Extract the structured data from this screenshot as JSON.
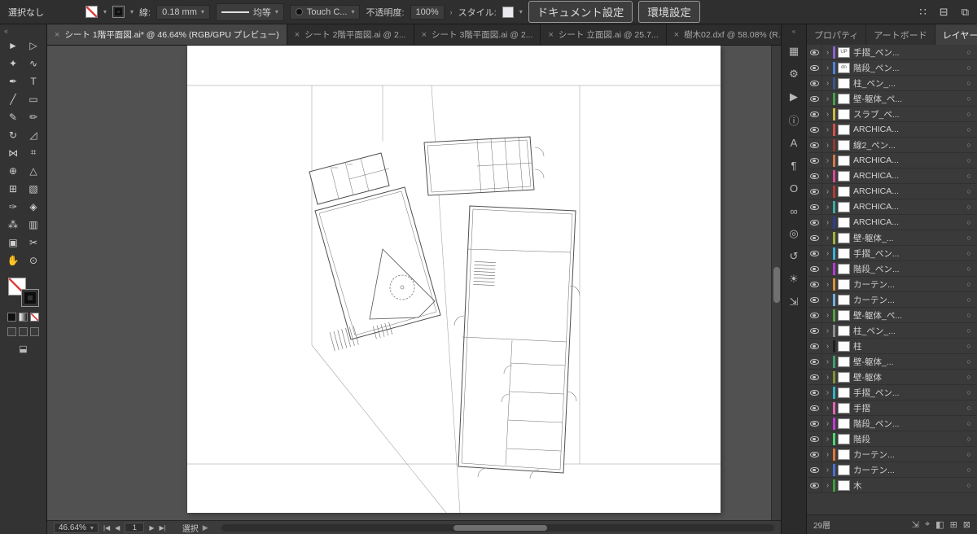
{
  "topbar": {
    "selection_status": "選択なし",
    "stroke_label": "線:",
    "stroke_width": "0.18 mm",
    "profile_label": "均等",
    "brush_name": "Touch C...",
    "opacity_label": "不透明度:",
    "opacity_value": "100%",
    "style_label": "スタイル:",
    "document_setup": "ドキュメント設定",
    "preferences": "環境設定",
    "right_icons": [
      {
        "name": "app-grid-icon",
        "glyph": "∷"
      },
      {
        "name": "panel-layout-icon",
        "glyph": "⊟"
      },
      {
        "name": "arrange-documents-icon",
        "glyph": "⧉"
      }
    ]
  },
  "toolbar": {
    "collapse_glyph": "«",
    "tools": [
      {
        "name": "selection-tool",
        "glyph": "►"
      },
      {
        "name": "direct-selection-tool",
        "glyph": "▷"
      },
      {
        "name": "magic-wand-tool",
        "glyph": "✦"
      },
      {
        "name": "lasso-tool",
        "glyph": "∿"
      },
      {
        "name": "pen-tool",
        "glyph": "✒"
      },
      {
        "name": "type-tool",
        "glyph": "T"
      },
      {
        "name": "line-segment-tool",
        "glyph": "╱"
      },
      {
        "name": "rectangle-tool",
        "glyph": "▭"
      },
      {
        "name": "paintbrush-tool",
        "glyph": "✎"
      },
      {
        "name": "pencil-tool",
        "glyph": "✏"
      },
      {
        "name": "rotate-tool",
        "glyph": "↻"
      },
      {
        "name": "scale-tool",
        "glyph": "◿"
      },
      {
        "name": "width-tool",
        "glyph": "⋈"
      },
      {
        "name": "free-transform-tool",
        "glyph": "⌗"
      },
      {
        "name": "shape-builder-tool",
        "glyph": "⊕"
      },
      {
        "name": "perspective-grid-tool",
        "glyph": "△"
      },
      {
        "name": "mesh-tool",
        "glyph": "⊞"
      },
      {
        "name": "gradient-tool",
        "glyph": "▧"
      },
      {
        "name": "eyedropper-tool",
        "glyph": "✑"
      },
      {
        "name": "blend-tool",
        "glyph": "◈"
      },
      {
        "name": "symbol-sprayer-tool",
        "glyph": "⁂"
      },
      {
        "name": "column-graph-tool",
        "glyph": "▥"
      },
      {
        "name": "artboard-tool",
        "glyph": "▣"
      },
      {
        "name": "slice-tool",
        "glyph": "✂"
      },
      {
        "name": "hand-tool",
        "glyph": "✋"
      },
      {
        "name": "zoom-tool",
        "glyph": "⊙"
      }
    ]
  },
  "tabs": [
    {
      "label": "シート 1階平面図.ai* @ 46.64% (RGB/GPU プレビュー)",
      "active": true
    },
    {
      "label": "シート 2階平面図.ai @ 2...",
      "active": false
    },
    {
      "label": "シート 3階平面図.ai @ 2...",
      "active": false
    },
    {
      "label": "シート 立面図.ai @ 25.7...",
      "active": false
    },
    {
      "label": "樹木02.dxf @ 58.08% (R...",
      "active": false
    }
  ],
  "dock": {
    "collapse_glyph": "«",
    "icons": [
      {
        "name": "artboards-icon",
        "glyph": "▦"
      },
      {
        "name": "gear-icon",
        "glyph": "⚙"
      },
      {
        "name": "actions-play-icon",
        "glyph": "▶"
      },
      {
        "name": "info-icon",
        "glyph": "ⓘ"
      },
      {
        "name": "character-icon",
        "glyph": "A"
      },
      {
        "name": "paragraph-icon",
        "glyph": "¶"
      },
      {
        "name": "opentype-icon",
        "glyph": "O"
      },
      {
        "name": "links-icon",
        "glyph": "∞"
      },
      {
        "name": "graphic-styles-icon",
        "glyph": "◎"
      },
      {
        "name": "history-icon",
        "glyph": "↺"
      },
      {
        "name": "adjustments-icon",
        "glyph": "☀"
      },
      {
        "name": "export-icon",
        "glyph": "⇲"
      }
    ]
  },
  "panel": {
    "tabs": [
      {
        "label": "プロパティ",
        "active": false
      },
      {
        "label": "アートボード",
        "active": false
      },
      {
        "label": "レイヤー",
        "active": true
      }
    ],
    "menu_glyph": "≡",
    "layers": [
      {
        "name": "手摺_ペン...",
        "color": "#8a63d2",
        "thumb": "UP"
      },
      {
        "name": "階段_ペン...",
        "color": "#4f82d8",
        "thumb": "dn"
      },
      {
        "name": "柱_ペン_...",
        "color": "#39568f",
        "thumb": ""
      },
      {
        "name": "壁-躯体_ペ...",
        "color": "#46a04c",
        "thumb": ""
      },
      {
        "name": "スラブ_ペ...",
        "color": "#cdb93e",
        "thumb": ""
      },
      {
        "name": "ARCHICA...",
        "color": "#d4504a",
        "thumb": ""
      },
      {
        "name": "線2_ペン...",
        "color": "#93382f",
        "thumb": ""
      },
      {
        "name": "ARCHICA...",
        "color": "#d4764a",
        "thumb": ""
      },
      {
        "name": "ARCHICA...",
        "color": "#d44a93",
        "thumb": ""
      },
      {
        "name": "ARCHICA...",
        "color": "#b23a3a",
        "thumb": ""
      },
      {
        "name": "ARCHICA...",
        "color": "#3aada0",
        "thumb": ""
      },
      {
        "name": "ARCHICA...",
        "color": "#2f3f93",
        "thumb": ""
      },
      {
        "name": "壁-躯体_...",
        "color": "#a0b23a",
        "thumb": ""
      },
      {
        "name": "手摺_ペン...",
        "color": "#3ab2d8",
        "thumb": ""
      },
      {
        "name": "階段_ペン...",
        "color": "#b23ad8",
        "thumb": ""
      },
      {
        "name": "カーテン...",
        "color": "#d8933a",
        "thumb": ""
      },
      {
        "name": "カーテン...",
        "color": "#6fb2e0",
        "thumb": ""
      },
      {
        "name": "壁-躯体_ペ...",
        "color": "#55a03f",
        "thumb": ""
      },
      {
        "name": "柱_ペン_...",
        "color": "#8d8d8d",
        "thumb": ""
      },
      {
        "name": "柱",
        "color": "#202020",
        "thumb": ""
      },
      {
        "name": "壁-躯体_...",
        "color": "#3fa06f",
        "thumb": ""
      },
      {
        "name": "壁-躯体",
        "color": "#7f9333",
        "thumb": ""
      },
      {
        "name": "手摺_ペン...",
        "color": "#33b2c4",
        "thumb": ""
      },
      {
        "name": "手摺",
        "color": "#e063b2",
        "thumb": ""
      },
      {
        "name": "階段_ペン...",
        "color": "#c43ad8",
        "thumb": ""
      },
      {
        "name": "階段",
        "color": "#4ad86f",
        "thumb": ""
      },
      {
        "name": "カーテン...",
        "color": "#e0763a",
        "thumb": ""
      },
      {
        "name": "カーテン...",
        "color": "#4a6fd8",
        "thumb": ""
      },
      {
        "name": "木",
        "color": "#3aa03a",
        "thumb": ""
      }
    ],
    "footer": {
      "count": "29層",
      "icons": [
        {
          "name": "collect-for-export-icon",
          "glyph": "⇲"
        },
        {
          "name": "locate-object-icon",
          "glyph": "⌖"
        },
        {
          "name": "make-mask-icon",
          "glyph": "◧"
        },
        {
          "name": "new-layer-icon",
          "glyph": "⊞"
        },
        {
          "name": "delete-layer-icon",
          "glyph": "⊠"
        }
      ]
    }
  },
  "statusbar": {
    "zoom": "46.64%",
    "nav_first": "|◀",
    "nav_prev": "◀",
    "page": "1",
    "nav_next": "▶",
    "nav_last": "▶|",
    "status_label": "選択",
    "flyout_glyph": "▶"
  }
}
